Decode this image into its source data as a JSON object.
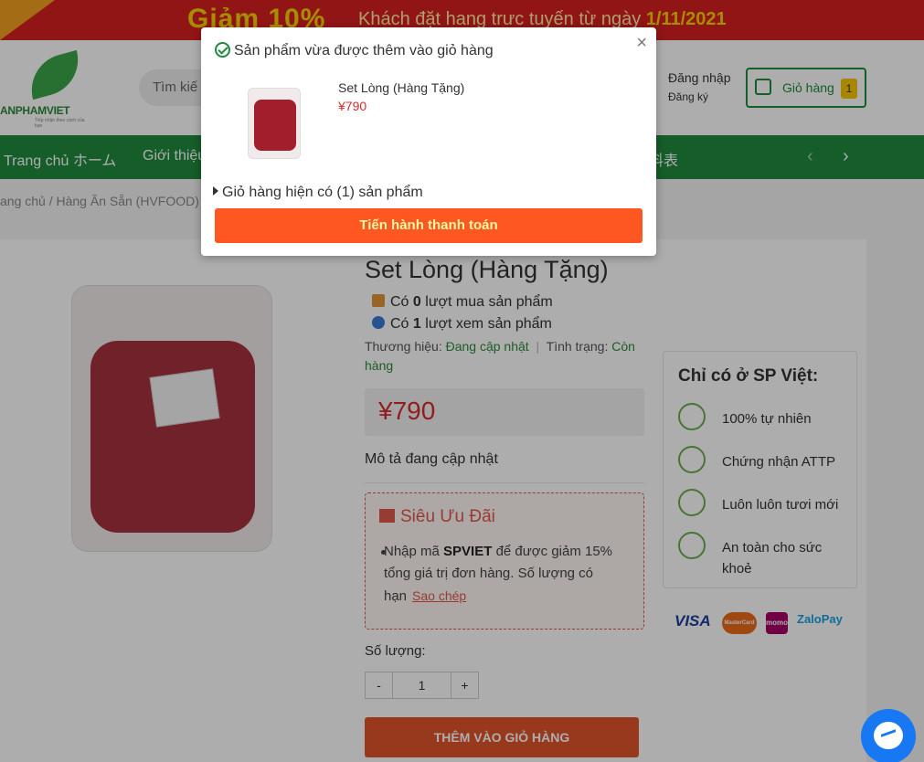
{
  "banner": {
    "promo": "Giảm 10%",
    "desc_prefix": "Khách đặt hang trưc tuyến từ ngày",
    "desc_date": "1/11/2021"
  },
  "header": {
    "logo_text": "ANPHAMVIET",
    "logo_tagline": "Tiếp nhận theo cách của bạn",
    "search_placeholder": "Tìm kiế",
    "login": "Đăng nhập",
    "register": "Đăng ký",
    "cart_label": "Giỏ hàng",
    "cart_count": "1"
  },
  "nav": {
    "items": [
      "Trang chủ ホーム",
      "Giới thiệu",
      "料表"
    ]
  },
  "breadcrumb": {
    "home": "ang chủ",
    "sep": "/",
    "category": "Hàng Ăn Sẵn (HVFOOD)"
  },
  "product": {
    "title": "Set Lòng (Hàng Tặng)",
    "purchased_prefix": "Có ",
    "purchased_count": "0",
    "purchased_suffix": " lượt mua sản phẩm",
    "viewed_prefix": "Có ",
    "viewed_count": "1",
    "viewed_suffix": " lượt xem sản phẩm",
    "brand_label": "Thương hiệu:",
    "brand_value": "Đang cập nhật",
    "status_label": "Tình trạng:",
    "status_value": "Còn hàng",
    "price": "¥790",
    "description": "Mô tả đang cập nhật",
    "qty_label": "Số lượng:",
    "qty_minus": "-",
    "qty_value": "1",
    "qty_plus": "+",
    "add_to_cart": "THÊM VÀO GIỎ HÀNG"
  },
  "deal": {
    "title": "Siêu Ưu Đãi",
    "text_prefix": "Nhập mã ",
    "code": "SPVIET",
    "text_suffix": " để được giảm 15% tổng giá trị đơn hàng. Số lượng có hạn",
    "copy": "Sao chép"
  },
  "side": {
    "heading": "Chỉ có ở SP Việt:",
    "items": [
      "100% tự nhiên",
      "Chứng nhận ATTP",
      "Luôn luôn tươi mới",
      "An toàn cho sức khoẻ"
    ]
  },
  "payments": [
    "VISA",
    "MasterCard",
    "momo",
    "ZaloPay"
  ],
  "modal": {
    "message": "Sản phẩm vừa được thêm vào giỏ hàng",
    "product_name": "Set Lòng (Hàng Tặng)",
    "product_price": "¥790",
    "cart_summary": "Giỏ hàng hiện có (1) sản phẩm",
    "checkout": "Tiến hành thanh toán",
    "close": "×"
  },
  "colors": {
    "green": "#1f8a3d",
    "orange": "#ff5722",
    "price_red": "#d82b2b",
    "banner_red": "#d8201f",
    "yellow": "#f6d000"
  }
}
